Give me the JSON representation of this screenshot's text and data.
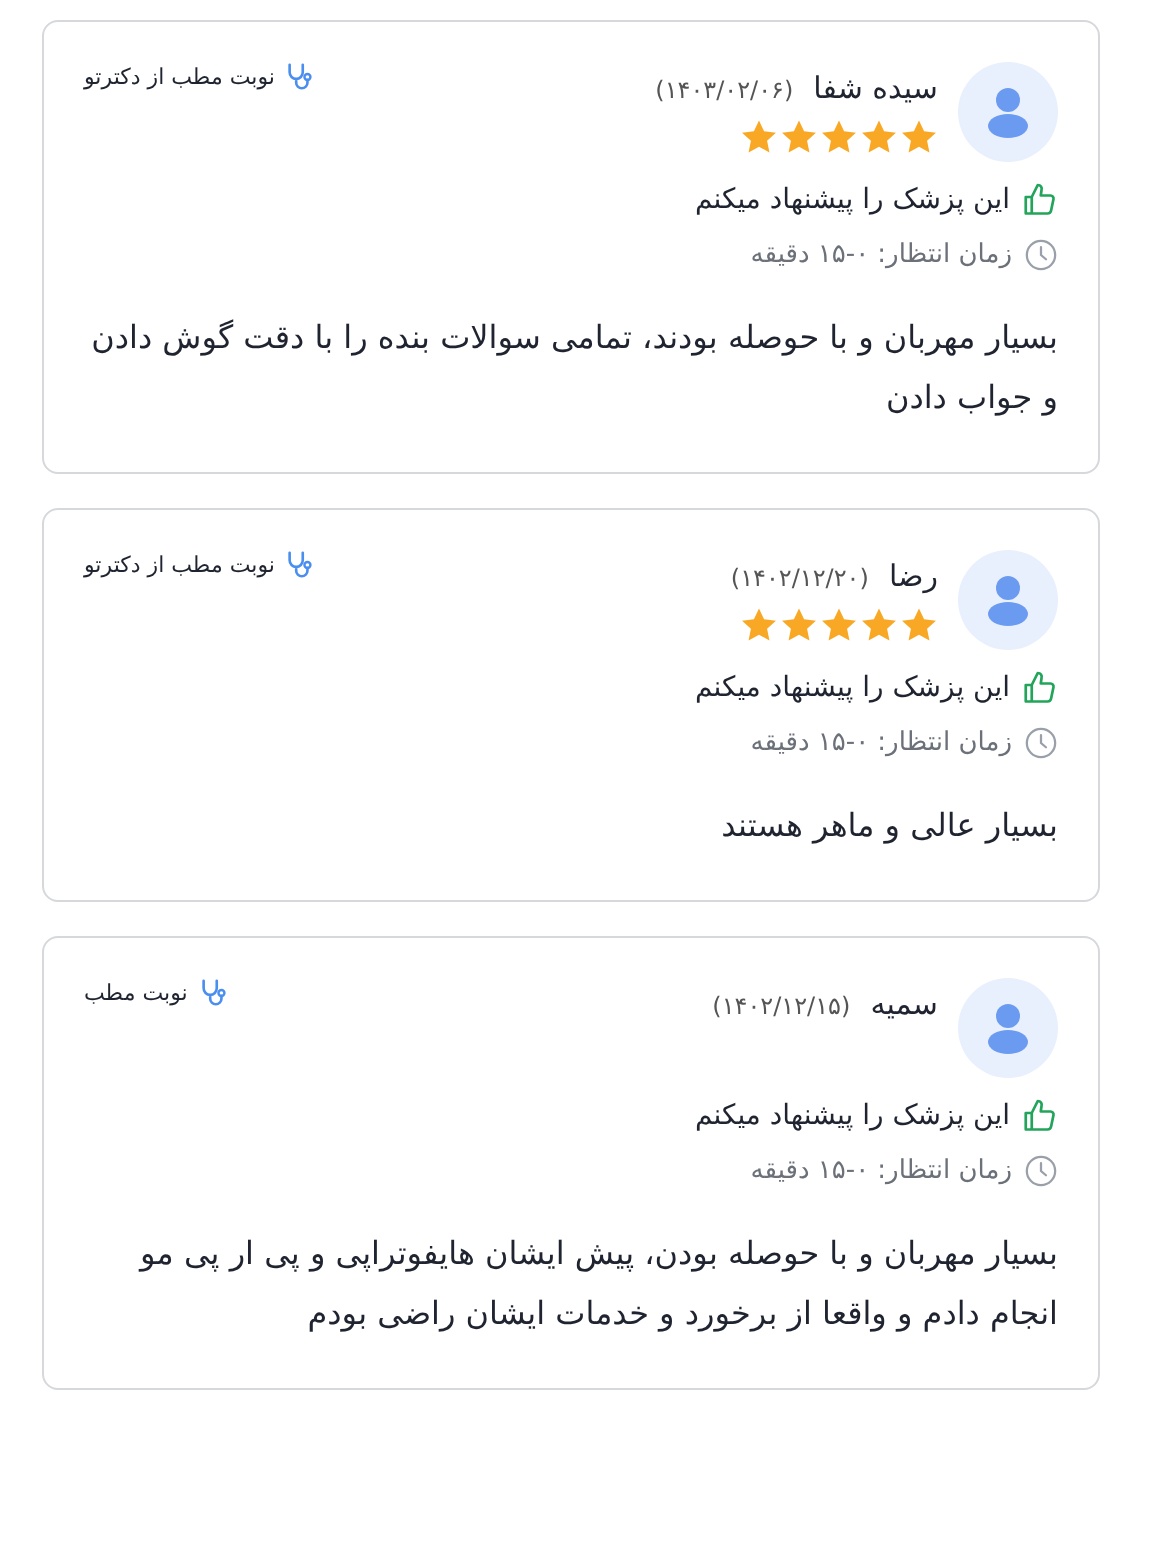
{
  "reviews": [
    {
      "name": "سیده شفا",
      "date": "(۱۴۰۳/۰۲/۰۶)",
      "stars": 5,
      "source": "نوبت مطب از دکترتو",
      "recommend": "این پزشک را پیشنهاد میکنم",
      "wait": "زمان انتظار: ۰-۱۵ دقیقه",
      "text": "بسیار مهربان و با حوصله بودند، تمامی سوالات بنده را با دقت گوش دادن و جواب دادن"
    },
    {
      "name": "رضا",
      "date": "(۱۴۰۲/۱۲/۲۰)",
      "stars": 5,
      "source": "نوبت مطب از دکترتو",
      "recommend": "این پزشک را پیشنهاد میکنم",
      "wait": "زمان انتظار: ۰-۱۵ دقیقه",
      "text": "بسیار عالی و ماهر هستند"
    },
    {
      "name": "سمیه",
      "date": "(۱۴۰۲/۱۲/۱۵)",
      "source": "نوبت مطب",
      "recommend": "این پزشک را پیشنهاد میکنم",
      "wait": "زمان انتظار: ۰-۱۵ دقیقه",
      "text": "بسیار مهربان و با حوصله بودن، پیش ایشان هایفوتراپی و پی ار پی مو انجام دادم و واقعا از برخورد و خدمات ایشان راضی بودم"
    }
  ]
}
